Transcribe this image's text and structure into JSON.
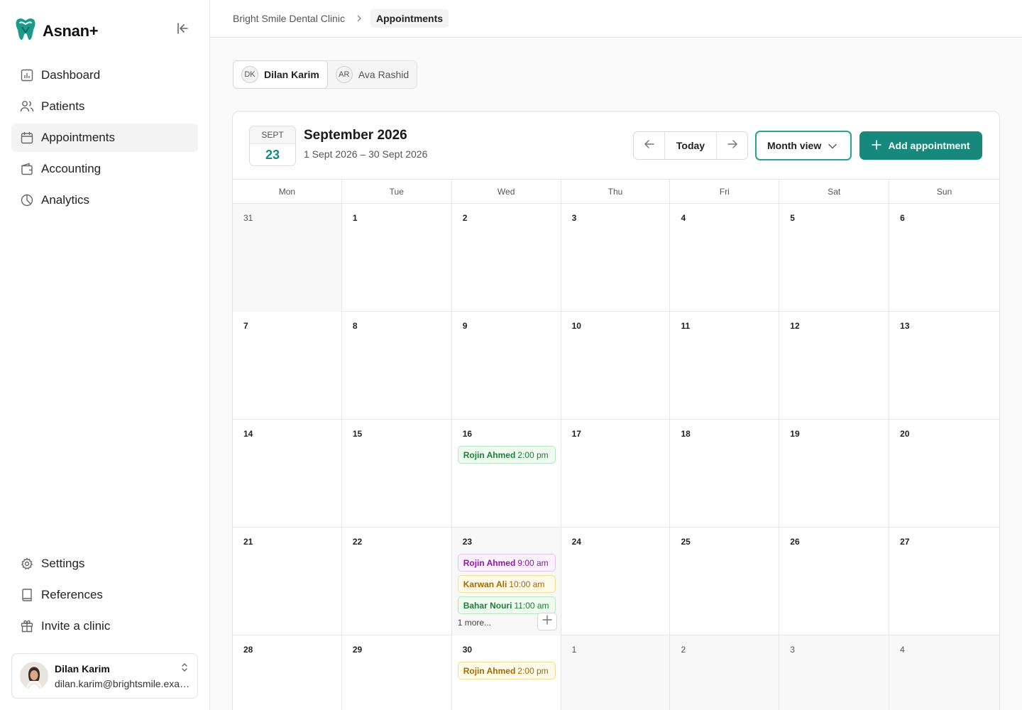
{
  "app": {
    "name": "Asnan+"
  },
  "colors": {
    "accent": "#17897c",
    "accent_border": "#26a391"
  },
  "sidebar": {
    "items": [
      {
        "label": "Dashboard",
        "icon": "bar-chart-icon"
      },
      {
        "label": "Patients",
        "icon": "users-icon"
      },
      {
        "label": "Appointments",
        "icon": "calendar-icon",
        "active": true
      },
      {
        "label": "Accounting",
        "icon": "wallet-icon"
      },
      {
        "label": "Analytics",
        "icon": "pie-chart-icon"
      }
    ],
    "bottom_items": [
      {
        "label": "Settings",
        "icon": "gear-icon"
      },
      {
        "label": "References",
        "icon": "book-icon"
      },
      {
        "label": "Invite a clinic",
        "icon": "gift-icon"
      }
    ],
    "user": {
      "name": "Dilan Karim",
      "email": "dilan.karim@brightsmile.example"
    }
  },
  "breadcrumb": {
    "clinic": "Bright Smile Dental Clinic",
    "page": "Appointments"
  },
  "doctors": [
    {
      "initials": "DK",
      "name": "Dilan Karim",
      "active": true
    },
    {
      "initials": "AR",
      "name": "Ava Rashid",
      "active": false
    }
  ],
  "calendar": {
    "badge_month": "SEPT",
    "badge_day": "23",
    "title": "September 2026",
    "range": "1 Sept 2026 – 30 Sept 2026",
    "today_label": "Today",
    "view_label": "Month view",
    "add_label": "Add appointment",
    "weekdays": [
      "Mon",
      "Tue",
      "Wed",
      "Thu",
      "Fri",
      "Sat",
      "Sun"
    ],
    "weeks": [
      [
        {
          "d": "31",
          "muted": true
        },
        {
          "d": "1"
        },
        {
          "d": "2"
        },
        {
          "d": "3"
        },
        {
          "d": "4"
        },
        {
          "d": "5"
        },
        {
          "d": "6"
        }
      ],
      [
        {
          "d": "7"
        },
        {
          "d": "8"
        },
        {
          "d": "9"
        },
        {
          "d": "10"
        },
        {
          "d": "11"
        },
        {
          "d": "12"
        },
        {
          "d": "13"
        }
      ],
      [
        {
          "d": "14"
        },
        {
          "d": "15"
        },
        {
          "d": "16",
          "events": [
            {
              "name": "Rojin Ahmed",
              "time": "2:00 pm",
              "color": "green"
            }
          ]
        },
        {
          "d": "17"
        },
        {
          "d": "18"
        },
        {
          "d": "19"
        },
        {
          "d": "20"
        }
      ],
      [
        {
          "d": "21"
        },
        {
          "d": "22"
        },
        {
          "d": "23",
          "today": true,
          "events": [
            {
              "name": "Rojin Ahmed",
              "time": "9:00 am",
              "color": "purple"
            },
            {
              "name": "Karwan Ali",
              "time": "10:00 am",
              "color": "yellow"
            },
            {
              "name": "Bahar Nouri",
              "time": "11:00 am",
              "color": "green"
            }
          ],
          "more": "1 more..."
        },
        {
          "d": "24"
        },
        {
          "d": "25"
        },
        {
          "d": "26"
        },
        {
          "d": "27"
        }
      ],
      [
        {
          "d": "28"
        },
        {
          "d": "29"
        },
        {
          "d": "30",
          "events": [
            {
              "name": "Rojin Ahmed",
              "time": "2:00 pm",
              "color": "yellow"
            }
          ]
        },
        {
          "d": "1",
          "muted": true
        },
        {
          "d": "2",
          "muted": true
        },
        {
          "d": "3",
          "muted": true
        },
        {
          "d": "4",
          "muted": true
        }
      ]
    ]
  }
}
